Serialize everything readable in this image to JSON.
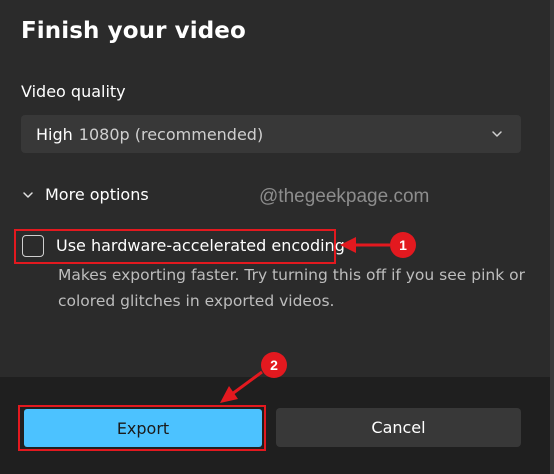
{
  "dialog": {
    "title": "Finish your video",
    "quality_label": "Video quality",
    "quality_select": {
      "main": "High",
      "sub": "1080p (recommended)"
    },
    "more_options": "More options",
    "hardware_checkbox": {
      "label": "Use hardware-accelerated encoding",
      "checked": false,
      "description": "Makes exporting faster. Try turning this off if you see pink or colored glitches in exported videos."
    },
    "buttons": {
      "export": "Export",
      "cancel": "Cancel"
    }
  },
  "annotations": {
    "watermark": "@thegeekpage.com",
    "badge1": "1",
    "badge2": "2",
    "accent_color": "#e3191f"
  },
  "colors": {
    "background": "#2b2b2b",
    "footer": "#1f1f1f",
    "export_button": "#4cc2ff",
    "control": "#383838"
  }
}
